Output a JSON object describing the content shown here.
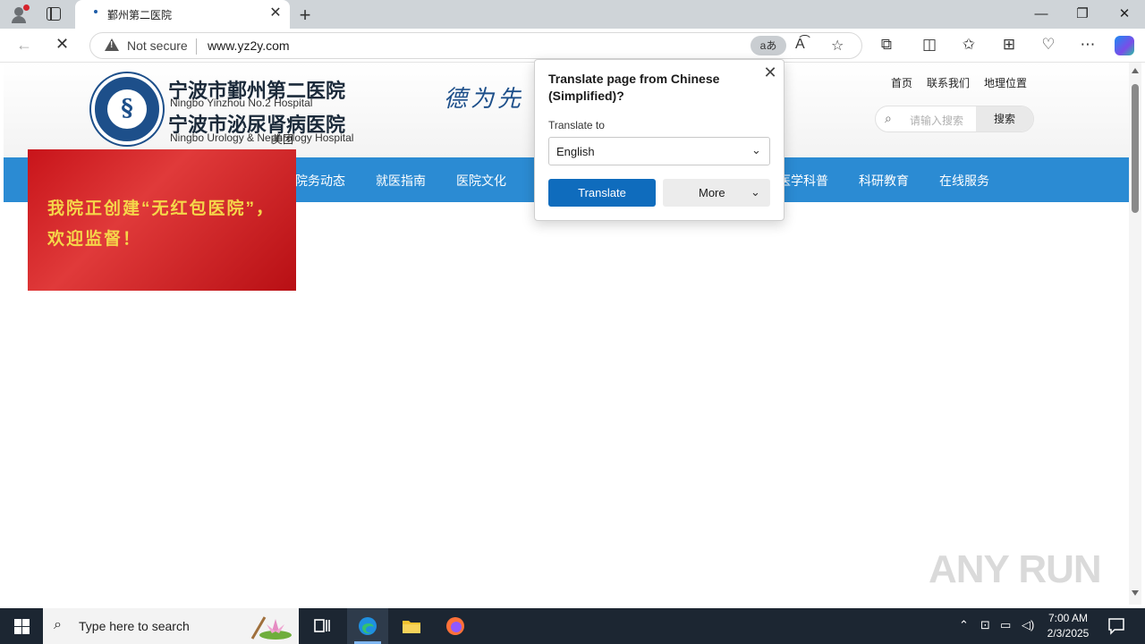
{
  "browser": {
    "tab_title": "鄞州第二医院",
    "tab_close": "✕",
    "new_tab": "+",
    "window_controls": {
      "minimize": "—",
      "restore": "❐",
      "close": "✕"
    },
    "address": {
      "security_label": "Not secure",
      "url": "www.yz2y.com",
      "translate_badge": "aあ"
    },
    "icons": [
      "read-aloud-icon",
      "favorite-star-icon",
      "extensions-icon",
      "split-screen-icon",
      "favorites-icon",
      "collections-icon",
      "performance-icon",
      "more-icon",
      "copilot-icon"
    ]
  },
  "site": {
    "name_cn_1": "宁波市鄞州第二医院",
    "name_en_1": "Ningbo Yinzhou No.2 Hospital",
    "name_cn_2": "宁波市泌尿肾病医院",
    "name_en_2": "Ningbo Urology & Nephrology Hospital",
    "calligraphy": "德为先 臻",
    "top_links": [
      "首页",
      "联系我们",
      "地理位置"
    ],
    "search": {
      "placeholder": "请输入搜索",
      "button": "搜索"
    },
    "menu": [
      "院务动态",
      "就医指南",
      "医院文化",
      "医学科普",
      "科研教育",
      "在线服务"
    ],
    "banner_text": "我院正创建“无红包医院”，欢迎监督！",
    "overlay_text": "美团"
  },
  "translate_popup": {
    "title": "Translate page from Chinese (Simplified)?",
    "label": "Translate to",
    "selected_language": "English",
    "translate_button": "Translate",
    "more_button": "More"
  },
  "watermark": "ANY RUN",
  "taskbar": {
    "search_placeholder": "Type here to search",
    "time": "7:00 AM",
    "date": "2/3/2025"
  },
  "colors": {
    "menu_bar": "#2b8bd3",
    "translate_primary": "#0f6cbd",
    "banner_red": "#c8141a",
    "banner_text": "#f5d64a"
  }
}
